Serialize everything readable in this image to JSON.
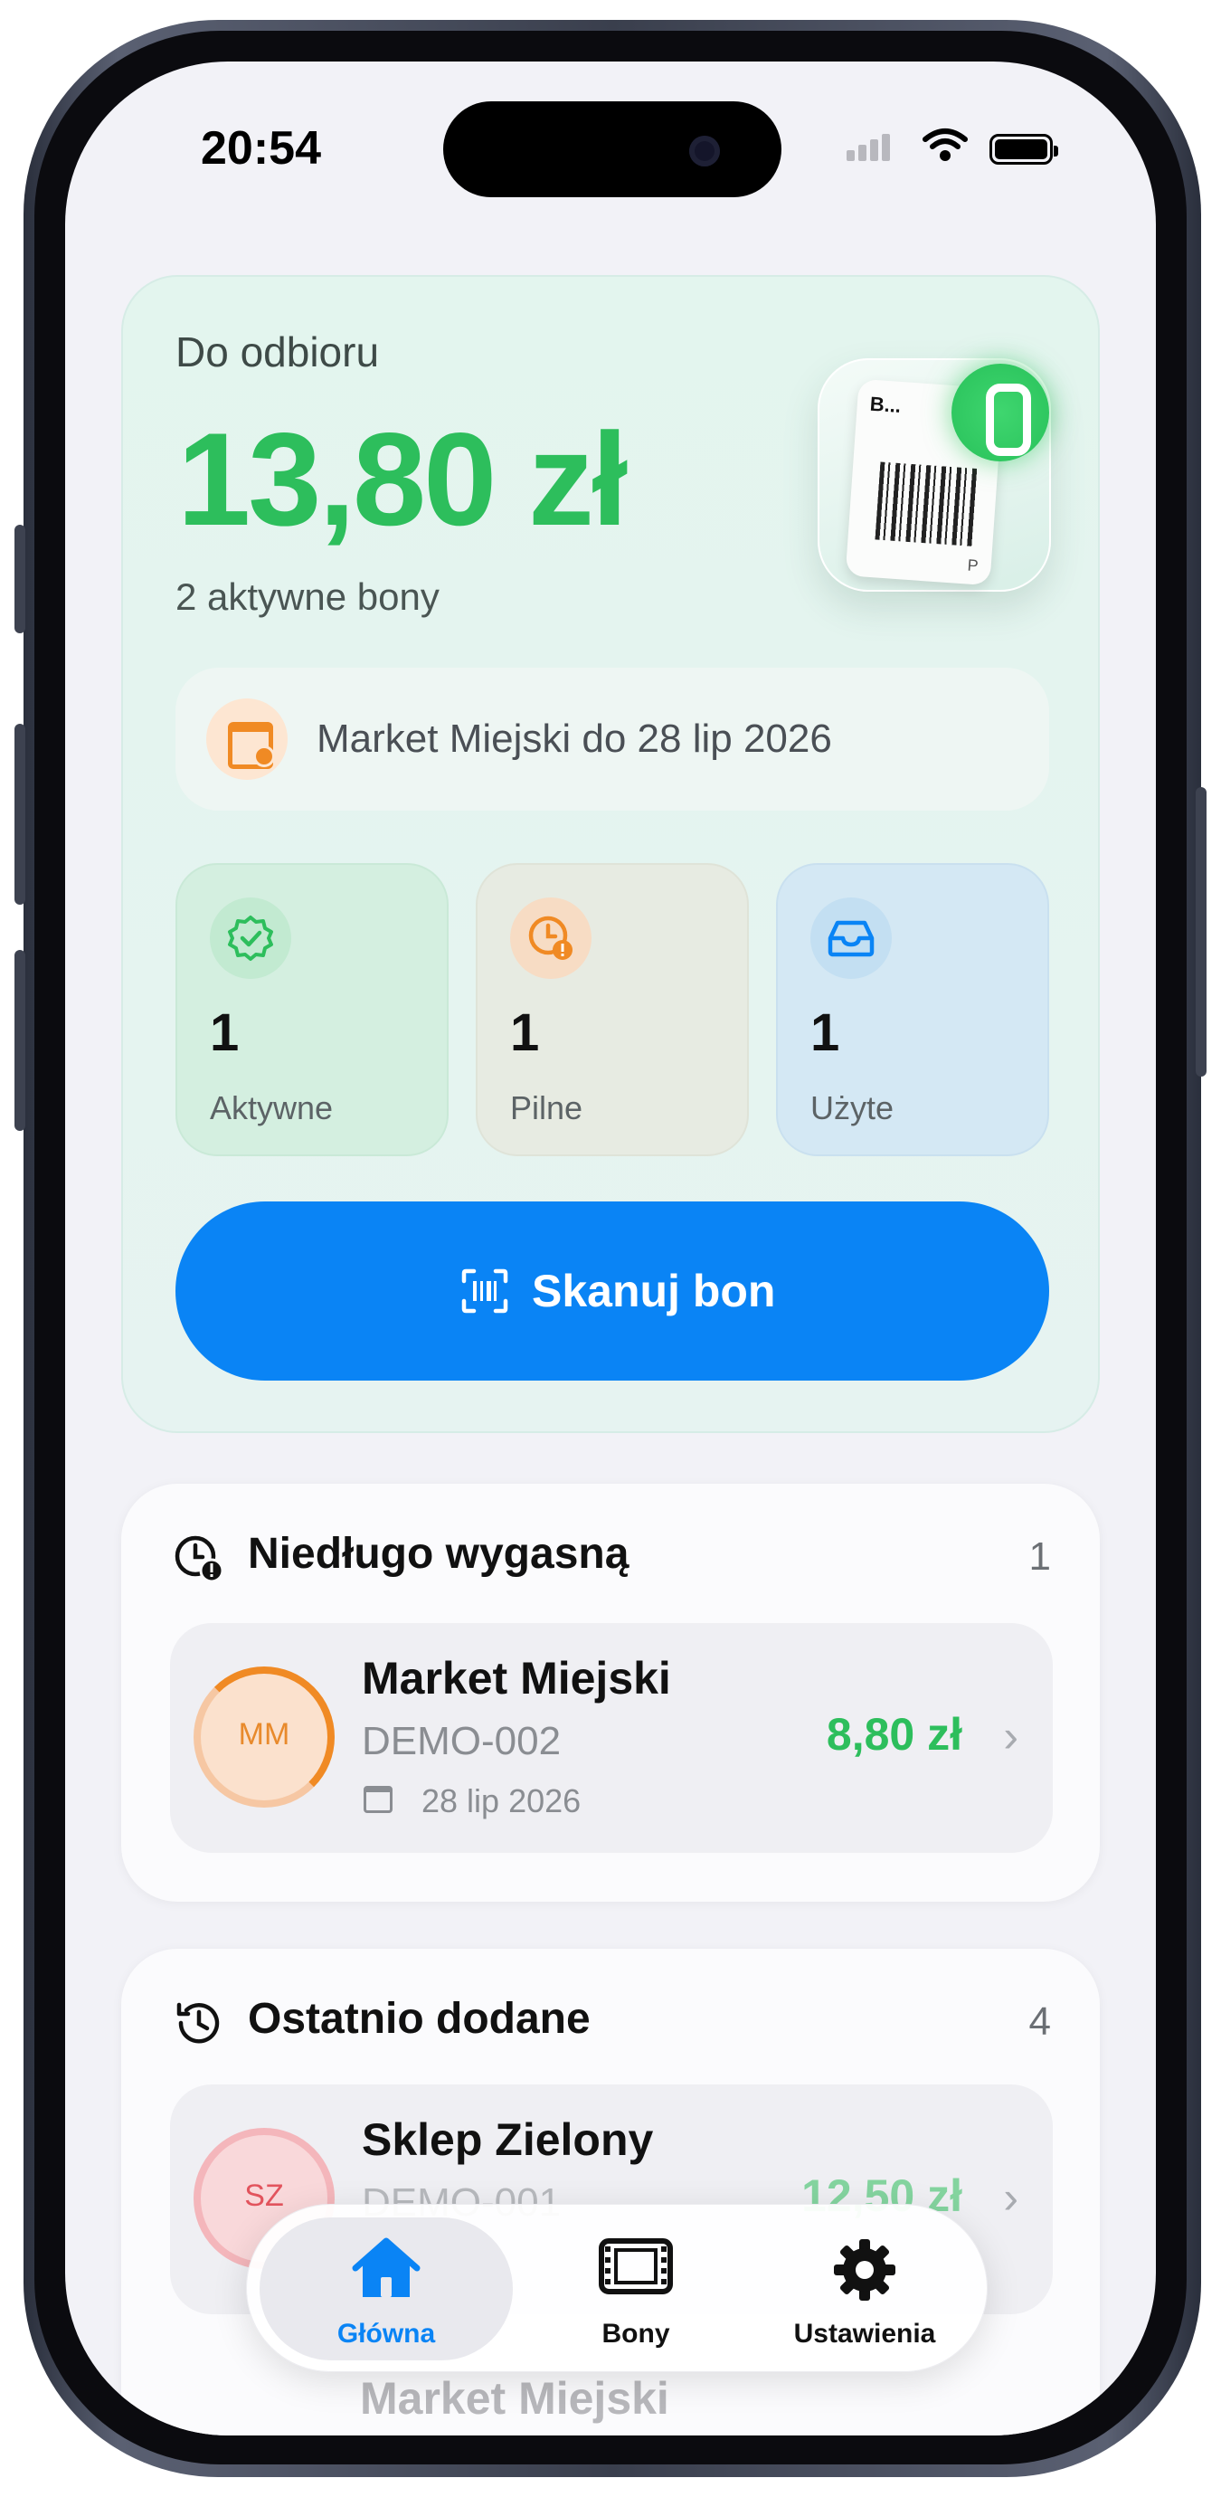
{
  "status_bar": {
    "time": "20:54"
  },
  "summary": {
    "label": "Do odbioru",
    "amount": "13,80 zł",
    "active_count_text": "2 aktywne bony",
    "app_icon": {
      "ticket_title": "B...",
      "ticket_letter": "P",
      "icon": "receipt-barcode-icon"
    },
    "next_expiry": "Market Miejski do 28 lip 2026",
    "stats": [
      {
        "value": "1",
        "label": "Aktywne",
        "icon": "verified-badge-icon",
        "color": "#2dbe5c"
      },
      {
        "value": "1",
        "label": "Pilne",
        "icon": "clock-alert-icon",
        "color": "#f08a24"
      },
      {
        "value": "1",
        "label": "Użyte",
        "icon": "inbox-tray-icon",
        "color": "#0a84f5"
      }
    ],
    "scan_button": "Skanuj bon"
  },
  "expiring": {
    "title": "Niedługo wygasną",
    "count": "1",
    "items": [
      {
        "initials": "MM",
        "name": "Market Miejski",
        "code": "DEMO-002",
        "date": "28 lip 2026",
        "amount": "8,80 zł"
      }
    ]
  },
  "recent": {
    "title": "Ostatnio dodane",
    "count": "4",
    "items": [
      {
        "initials": "SZ",
        "name": "Sklep Zielony",
        "code": "DEMO-001",
        "amount": "12,50 zł"
      },
      {
        "name": "Market Miejski"
      }
    ]
  },
  "tabbar": {
    "tabs": [
      {
        "label": "Główna",
        "icon": "house-icon",
        "selected": true
      },
      {
        "label": "Bony",
        "icon": "film-ticket-icon",
        "selected": false
      },
      {
        "label": "Ustawienia",
        "icon": "gear-icon",
        "selected": false
      }
    ]
  },
  "colors": {
    "accent": "#0a84f5",
    "positive": "#2dbe5c",
    "warning": "#f08a24",
    "danger": "#e2545d"
  }
}
